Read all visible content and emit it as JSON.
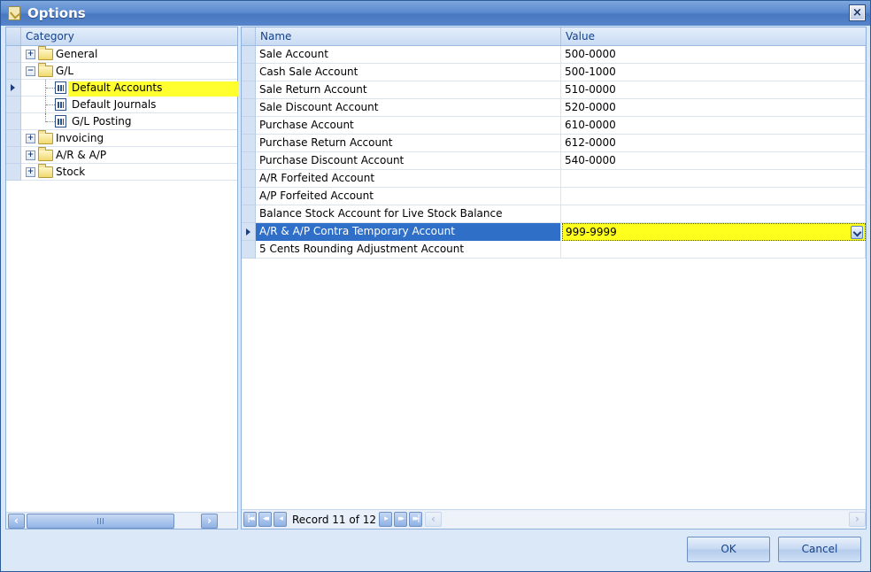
{
  "window": {
    "title": "Options",
    "close_label": "×"
  },
  "category_panel": {
    "header": "Category",
    "items": [
      {
        "label": "General",
        "type": "folder",
        "expanded": false
      },
      {
        "label": "G/L",
        "type": "folder",
        "expanded": true
      },
      {
        "label": "Default Accounts",
        "type": "document",
        "selected": true
      },
      {
        "label": "Default Journals",
        "type": "document"
      },
      {
        "label": "G/L Posting",
        "type": "document"
      },
      {
        "label": "Invoicing",
        "type": "folder",
        "expanded": false
      },
      {
        "label": "A/R & A/P",
        "type": "folder",
        "expanded": false
      },
      {
        "label": "Stock",
        "type": "folder",
        "expanded": false
      }
    ]
  },
  "grid": {
    "headers": {
      "name": "Name",
      "value": "Value"
    },
    "rows": [
      {
        "name": "Sale Account",
        "value": "500-0000"
      },
      {
        "name": "Cash Sale Account",
        "value": "500-1000"
      },
      {
        "name": "Sale Return Account",
        "value": "510-0000"
      },
      {
        "name": "Sale Discount Account",
        "value": "520-0000"
      },
      {
        "name": "Purchase Account",
        "value": "610-0000"
      },
      {
        "name": "Purchase Return Account",
        "value": "612-0000"
      },
      {
        "name": "Purchase Discount Account",
        "value": "540-0000"
      },
      {
        "name": "A/R Forfeited Account",
        "value": ""
      },
      {
        "name": "A/P Forfeited Account",
        "value": ""
      },
      {
        "name": "Balance Stock Account for Live Stock Balance",
        "value": ""
      },
      {
        "name": "A/R & A/P Contra Temporary Account",
        "value": "999-9999",
        "active": true
      },
      {
        "name": "5 Cents Rounding Adjustment Account",
        "value": ""
      }
    ],
    "navigator": {
      "record_text": "Record 11 of 12"
    }
  },
  "buttons": {
    "ok": "OK",
    "cancel": "Cancel"
  },
  "colors": {
    "selection_yellow": "#ffff1e",
    "active_row_blue": "#2f6fc8",
    "title_blue": "#5b8bd0"
  }
}
